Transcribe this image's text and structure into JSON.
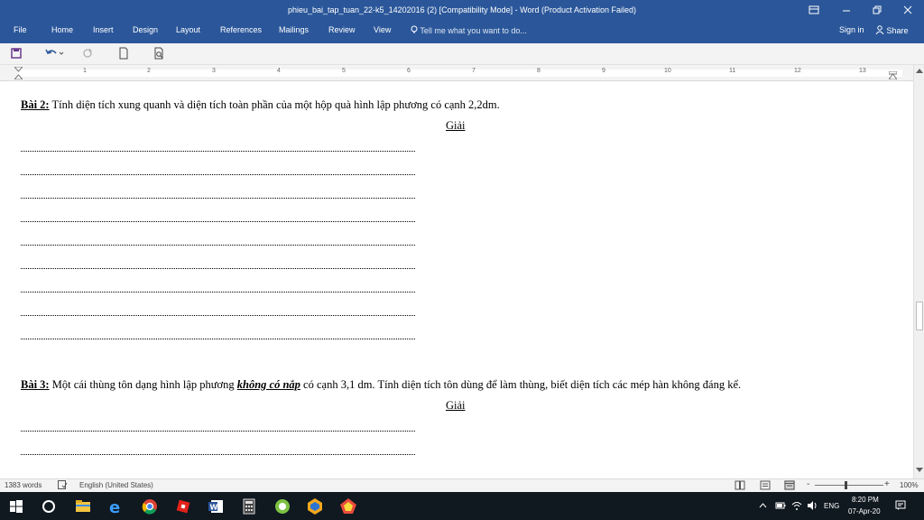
{
  "window": {
    "title": "phieu_bai_tap_tuan_22-k5_14202016 (2) [Compatibility Mode] - Word (Product Activation Failed)"
  },
  "ribbon": {
    "tabs": [
      "File",
      "Home",
      "Insert",
      "Design",
      "Layout",
      "References",
      "Mailings",
      "Review",
      "View"
    ],
    "tell_me": "Tell me what you want to do...",
    "sign_in": "Sign in",
    "share": "Share"
  },
  "ruler": {
    "numbers": [
      "1",
      "2",
      "3",
      "4",
      "5",
      "6",
      "7",
      "8",
      "9",
      "10",
      "11",
      "12",
      "13"
    ]
  },
  "document": {
    "bai2": {
      "label": "Bài 2:",
      "text": " Tính diện tích xung quanh và diện tích toàn phần của một hộp quà hình lập phương có cạnh 2,2dm."
    },
    "giai": "Giải",
    "bai3": {
      "label": "Bài 3:",
      "text_before": " Một cái thùng tôn dạng hình lập phương ",
      "emphasis": "không có nắp",
      "text_after": " có cạnh 3,1 dm. Tính diện tích tôn dùng để làm thùng, biết diện tích các mép hàn không đáng kể."
    }
  },
  "status": {
    "words": "1383 words",
    "language": "English (United States)",
    "zoom": "100%",
    "zoom_fraction": 0.45
  },
  "tray": {
    "lang": "ENG",
    "time": "8:20 PM",
    "date": "07-Apr-20"
  },
  "colors": {
    "word_blue": "#2b579a"
  }
}
